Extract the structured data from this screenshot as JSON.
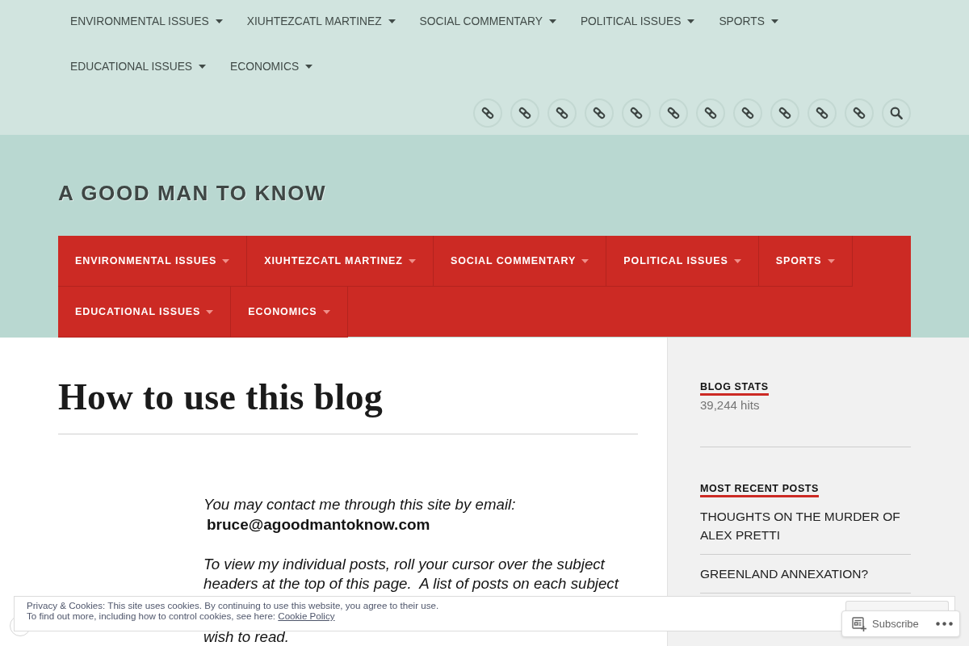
{
  "top_menu": [
    {
      "label": "ENVIRONMENTAL ISSUES",
      "has_submenu": true
    },
    {
      "label": "XIUHTEZCATL MARTINEZ",
      "has_submenu": true
    },
    {
      "label": "SOCIAL COMMENTARY",
      "has_submenu": true
    },
    {
      "label": "POLITICAL ISSUES",
      "has_submenu": true
    },
    {
      "label": "SPORTS",
      "has_submenu": true
    },
    {
      "label": "EDUCATIONAL ISSUES",
      "has_submenu": true
    },
    {
      "label": "ECONOMICS",
      "has_submenu": true
    }
  ],
  "icon_buttons": [
    {
      "kind": "link"
    },
    {
      "kind": "link"
    },
    {
      "kind": "link"
    },
    {
      "kind": "link"
    },
    {
      "kind": "link"
    },
    {
      "kind": "link"
    },
    {
      "kind": "link"
    },
    {
      "kind": "link"
    },
    {
      "kind": "link"
    },
    {
      "kind": "link"
    },
    {
      "kind": "link"
    },
    {
      "kind": "search"
    }
  ],
  "site_title": "A GOOD MAN TO KNOW",
  "main_menu": [
    {
      "label": "ENVIRONMENTAL ISSUES",
      "has_submenu": true
    },
    {
      "label": "XIUHTEZCATL MARTINEZ",
      "has_submenu": true
    },
    {
      "label": "SOCIAL COMMENTARY",
      "has_submenu": true
    },
    {
      "label": "POLITICAL ISSUES",
      "has_submenu": true
    },
    {
      "label": "SPORTS",
      "has_submenu": true
    },
    {
      "label": "EDUCATIONAL ISSUES",
      "has_submenu": true
    },
    {
      "label": "ECONOMICS",
      "has_submenu": true
    }
  ],
  "page": {
    "title": "How to use this blog",
    "contact_line": "You may contact me through this site by email:",
    "email": "bruce@agoodmantoknow.com",
    "paragraph_lines": [
      "To view my individual posts, roll your cursor over the subject",
      "headers at the top of this page.  A list of posts on each subject"
    ],
    "paragraph_tail": "wish to read."
  },
  "sidebar": {
    "widgets": [
      {
        "kind": "stats",
        "title": "BLOG STATS",
        "text": "39,244 hits"
      },
      {
        "kind": "posts",
        "title": "MOST RECENT POSTS",
        "items": [
          "THOUGHTS ON THE MURDER OF ALEX PRETTI",
          "GREENLAND ANNEXATION?"
        ]
      }
    ]
  },
  "cookie_banner": {
    "lines": [
      "Privacy & Cookies: This site uses cookies. By continuing to use this website, you agree to their use.",
      "To find out more, including how to control cookies, see here:"
    ],
    "link": "Cookie Policy"
  },
  "subscribe_bar": {
    "label": "Subscribe"
  }
}
